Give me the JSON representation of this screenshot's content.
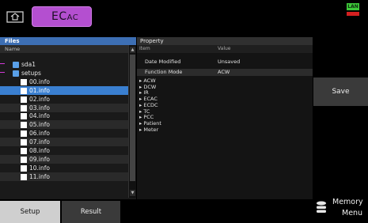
{
  "mode_label_main": "EC",
  "mode_label_sub": "AC",
  "status": {
    "lan": "LAN",
    "lan_color": "#3ec93a",
    "alarm_color": "#d42020"
  },
  "files": {
    "title": "Files",
    "column": "Name",
    "items": [
      {
        "name": "sda1",
        "type": "folder"
      },
      {
        "name": "setups",
        "type": "folder"
      },
      {
        "name": "00.info",
        "type": "file"
      },
      {
        "name": "01.info",
        "type": "file",
        "selected": true
      },
      {
        "name": "02.info",
        "type": "file"
      },
      {
        "name": "03.info",
        "type": "file"
      },
      {
        "name": "04.info",
        "type": "file"
      },
      {
        "name": "05.info",
        "type": "file"
      },
      {
        "name": "06.info",
        "type": "file"
      },
      {
        "name": "07.info",
        "type": "file"
      },
      {
        "name": "08.info",
        "type": "file"
      },
      {
        "name": "09.info",
        "type": "file"
      },
      {
        "name": "10.info",
        "type": "file"
      },
      {
        "name": "11.info",
        "type": "file"
      }
    ]
  },
  "property": {
    "title": "Property",
    "col_item": "Item",
    "col_value": "Value",
    "rows": [
      {
        "item": "Date Modified",
        "value": "Unsaved"
      },
      {
        "item": "Function Mode",
        "value": "ACW"
      }
    ],
    "groups": [
      "ACW",
      "DCW",
      "IR",
      "ECAC",
      "ECDC",
      "TC",
      "PCC",
      "Patient",
      "Meter"
    ]
  },
  "buttons": {
    "save": "Save",
    "memory_line1": "Memory",
    "memory_line2": "Menu"
  },
  "tabs": {
    "setup": "Setup",
    "result": "Result"
  },
  "colors": {
    "accent": "#3d6fb4",
    "selection": "#3a7fd0",
    "mode_pill": "#b44fd0"
  }
}
